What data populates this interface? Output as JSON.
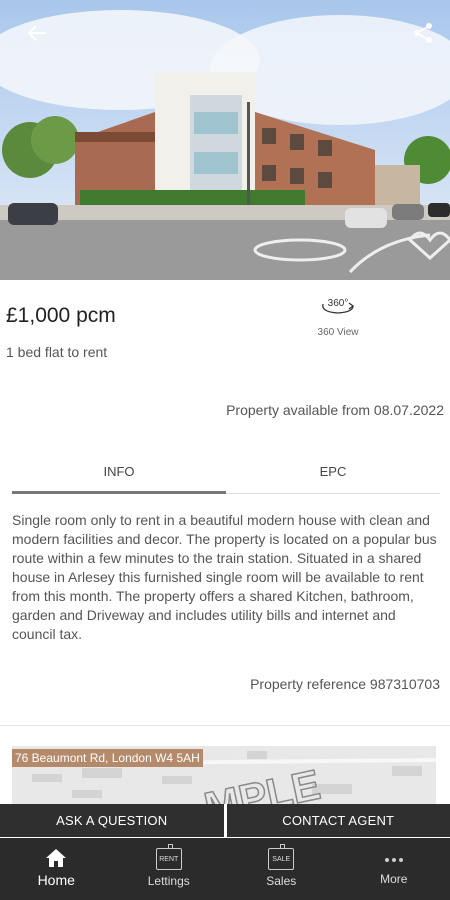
{
  "listing": {
    "price": "£1,000 pcm",
    "subtitle": "1 bed flat to rent",
    "view360_label": "360 View",
    "available": "Property available from 08.07.2022",
    "description": "Single room only to rent in a beautiful modern house with clean and modern facilities and decor. The property is located on a popular bus route within a few minutes to the train station. Situated in a shared house in Arlesey this furnished single room will be available to rent from this month. The property offers a shared Kitchen, bathroom, garden and Driveway and includes utility bills and internet and council tax.",
    "reference": "Property reference 987310703"
  },
  "tabs": [
    {
      "label": "INFO"
    },
    {
      "label": "EPC"
    }
  ],
  "map": {
    "address": "76 Beaumont Rd, London W4 5AH",
    "watermark": "MPLE"
  },
  "actions": {
    "ask": "ASK A QUESTION",
    "contact": "CONTACT AGENT"
  },
  "nav": [
    {
      "label": "Home",
      "icon": "home-icon"
    },
    {
      "label": "Lettings",
      "icon": "rent-sign-icon",
      "tag": "RENT"
    },
    {
      "label": "Sales",
      "icon": "sale-sign-icon",
      "tag": "SALE"
    },
    {
      "label": "More",
      "icon": "more-dots-icon"
    }
  ],
  "colors": {
    "dark": "#2f2f2f",
    "nav": "#2b2b2b",
    "address_tag": "#b58a6b"
  }
}
